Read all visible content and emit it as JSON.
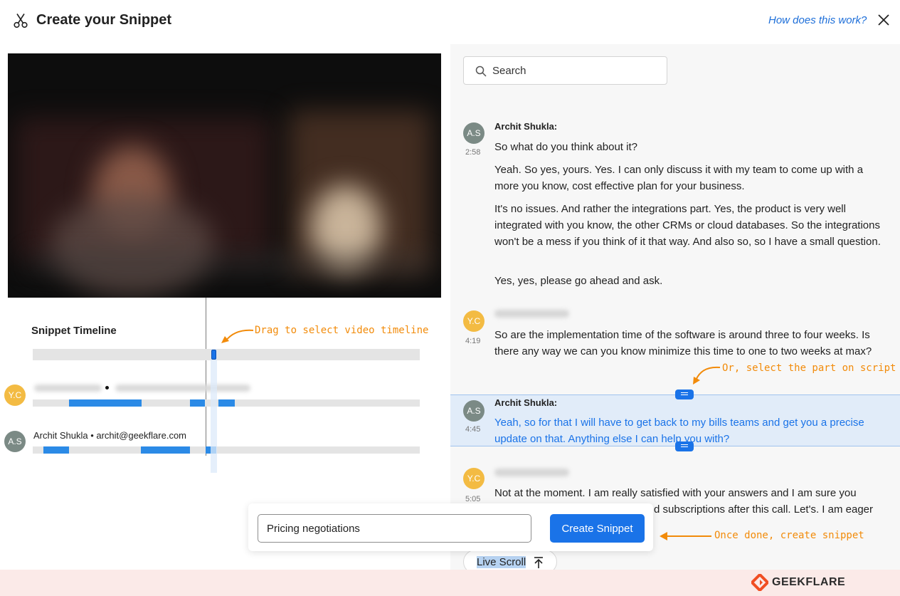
{
  "header": {
    "title": "Create your Snippet",
    "help_link": "How does this work?"
  },
  "timeline": {
    "title": "Snippet Timeline",
    "tracks": [
      {
        "speaker_initials": "Y.C",
        "speaker_label": ""
      },
      {
        "speaker_initials": "A.S",
        "speaker_label": "Archit Shukla • archit@geekflare.com"
      }
    ]
  },
  "search": {
    "placeholder": "Search"
  },
  "transcript": [
    {
      "initials": "A.S",
      "time": "2:58",
      "speaker": "Archit Shukla:",
      "paragraphs": [
        "So what do you think about it?",
        "Yeah. So yes, yours. Yes. I can only discuss it with my team to come up with a more you know, cost effective plan for your business.",
        "It's no issues. And rather the integrations part. Yes, the product is very well integrated with you know, the other CRMs or cloud databases. So the integrations won't be a mess if you think of it that way. And also so, so I have a small question.",
        "Yes, yes, please go ahead and ask."
      ]
    },
    {
      "initials": "Y.C",
      "time": "4:19",
      "speaker": "",
      "paragraphs": [
        "So are the implementation time of the software is around three to four weeks. Is there any way we can you know minimize this time to one to two weeks at max?"
      ]
    },
    {
      "initials": "A.S",
      "time": "4:45",
      "speaker": "Archit Shukla:",
      "highlighted": true,
      "paragraphs": [
        "Yeah, so for that I will have to get back to my bills teams and get you a precise update on that. Anything else I can help you with?"
      ]
    },
    {
      "initials": "Y.C",
      "time": "5:05",
      "speaker": "",
      "paragraphs": [
        "Not at the moment. I am really satisfied with your answers and I am sure you",
        "d subscriptions after this call. Let's. I am eager"
      ]
    }
  ],
  "live_scroll": {
    "label": "Live Scroll",
    "icon": "arrow-up-to-top-icon"
  },
  "snippet": {
    "name_value": "Pricing negotiations",
    "create_label": "Create Snippet"
  },
  "annotations": {
    "drag": "Drag to select video timeline",
    "script": "Or, select the part on script",
    "create": "Once done, create snippet"
  },
  "brand": {
    "name": "GEEKFLARE"
  },
  "colors": {
    "accent": "#1a73e8",
    "annotation": "#f28b0a",
    "avatar_yc": "#f3bb43",
    "avatar_as": "#7b8a85",
    "highlight_bg": "#e1ecf9",
    "footer_bg": "#fbeae8"
  }
}
